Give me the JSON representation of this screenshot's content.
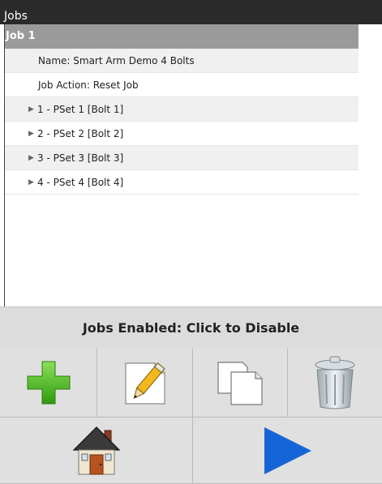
{
  "window": {
    "title": "Jobs"
  },
  "job": {
    "header": "Job 1",
    "name_line": "Name: Smart Arm Demo 4 Bolts",
    "action_line": "Job Action: Reset Job",
    "psets": [
      {
        "label": "1 - PSet 1 [Bolt 1]"
      },
      {
        "label": "2 - PSet 2 [Bolt 2]"
      },
      {
        "label": "3 - PSet 3 [Bolt 3]"
      },
      {
        "label": "4 - PSet 4 [Bolt 4]"
      }
    ]
  },
  "status": {
    "label": "Jobs Enabled: Click to Disable"
  },
  "toolbar": {
    "icons": [
      "plus-icon",
      "pencil-icon",
      "copy-icon",
      "trash-icon",
      "home-icon",
      "play-icon"
    ]
  },
  "colors": {
    "accent_green": "#3aa815",
    "play_blue": "#1565d8",
    "header_gray": "#9a9a9a"
  }
}
